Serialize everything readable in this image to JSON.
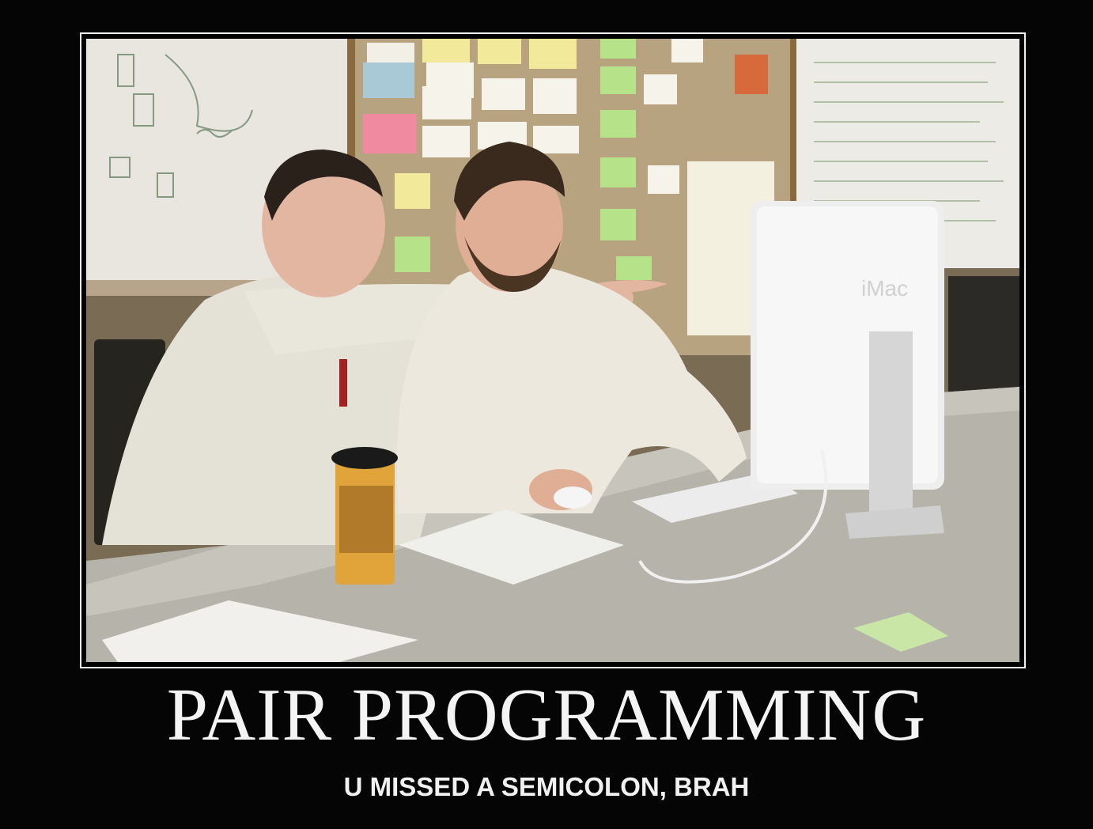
{
  "poster": {
    "title": "PAIR PROGRAMMING",
    "subtitle": "U MISSED A SEMICOLON, BRAH"
  },
  "photo": {
    "computer_brand_label": "iMac"
  },
  "colors": {
    "background": "#050505",
    "frame_border": "#f2f2f2",
    "caption_text": "#f4f4f4"
  }
}
